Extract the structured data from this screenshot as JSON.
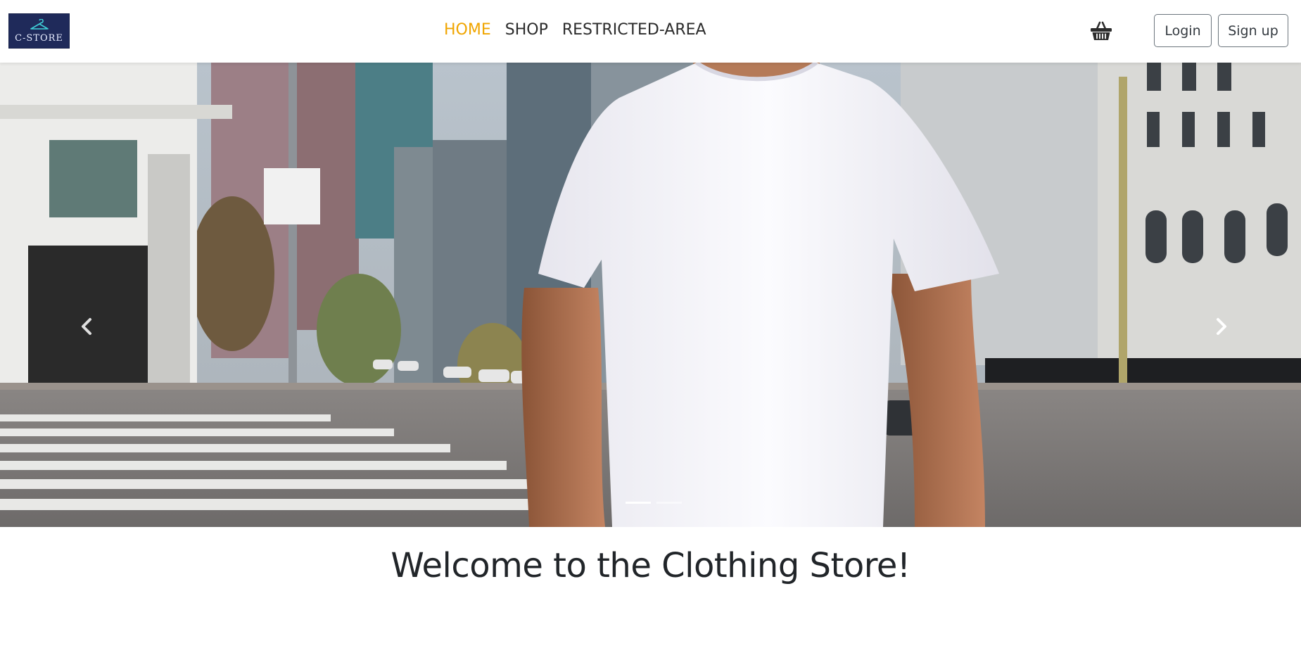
{
  "brand": {
    "logo_text": "C-STORE",
    "bg_color": "#1f2a5a"
  },
  "nav": {
    "links": [
      {
        "label": "HOME",
        "active": true
      },
      {
        "label": "SHOP",
        "active": false
      },
      {
        "label": "RESTRICTED-AREA",
        "active": false
      }
    ],
    "active_color": "#f0a500"
  },
  "header_actions": {
    "basket_icon": "basket-icon",
    "login_label": "Login",
    "signup_label": "Sign up"
  },
  "carousel": {
    "slide_count": 2,
    "active_index": 0,
    "prev_icon": "chevron-left-icon",
    "next_icon": "chevron-right-icon"
  },
  "main": {
    "heading": "Welcome to the Clothing Store!"
  }
}
